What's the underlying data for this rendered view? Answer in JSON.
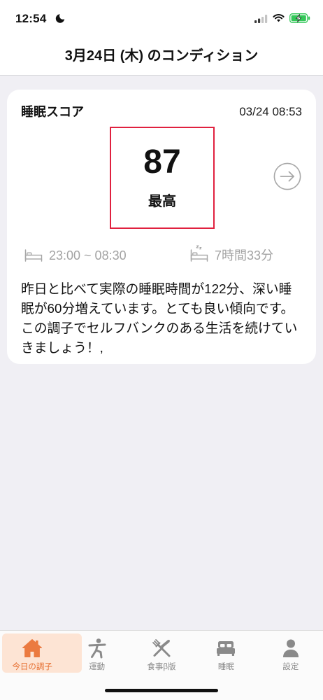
{
  "status_bar": {
    "time": "12:54",
    "focus_icon": "moon-icon",
    "signal_icon": "cellular-signal-icon",
    "wifi_icon": "wifi-icon",
    "battery_icon": "battery-charging-icon"
  },
  "header": {
    "title": "3月24日 (木) のコンディション"
  },
  "sleep_card": {
    "title": "睡眠スコア",
    "timestamp": "03/24 08:53",
    "score": "87",
    "score_label": "最高",
    "detail_icon": "arrow-right-circle-icon",
    "bed_icon": "bed-icon",
    "bedtime_range": "23:00 ~ 08:30",
    "sleep_icon": "sleeping-bed-icon",
    "duration": "7時間33分",
    "message": "昨日と比べて実際の睡眠時間が122分、深い睡眠が60分増えています。とても良い傾向です。この調子でセルフバンクのある生活を続けていきましょう！,"
  },
  "tab_bar": {
    "tabs": [
      {
        "label": "今日の調子",
        "icon": "house-icon",
        "active": true
      },
      {
        "label": "運動",
        "icon": "exercise-icon",
        "active": false
      },
      {
        "label": "食事β版",
        "icon": "fork-knife-icon",
        "active": false
      },
      {
        "label": "睡眠",
        "icon": "bed-icon",
        "active": false
      },
      {
        "label": "設定",
        "icon": "person-icon",
        "active": false
      }
    ]
  },
  "colors": {
    "accent": "#e66d2e",
    "accent_background": "#fde4d4",
    "score_border": "#e0213f",
    "muted_text": "#a3a3a3",
    "battery": "#34c759"
  }
}
